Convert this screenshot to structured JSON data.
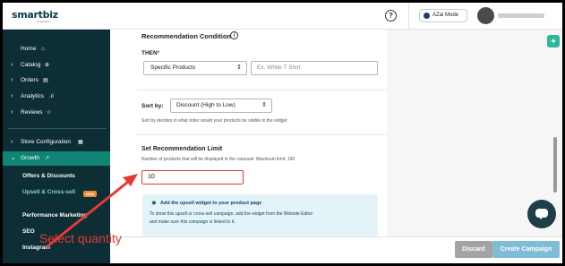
{
  "brand": {
    "logo": "smartbiz",
    "logo_sub": "by amazon"
  },
  "sidebar": {
    "items": [
      {
        "label": "Home",
        "icon": "home-icon"
      },
      {
        "label": "Catalog",
        "icon": "catalog-icon"
      },
      {
        "label": "Orders",
        "icon": "orders-icon"
      },
      {
        "label": "Analytics",
        "icon": "analytics-icon"
      },
      {
        "label": "Reviews",
        "icon": "star-icon"
      },
      {
        "label": "Store Configuration",
        "icon": "store-icon"
      },
      {
        "label": "Growth",
        "icon": "growth-icon"
      }
    ],
    "growth_sub": [
      "Offers & Discounts",
      "Upsell & Cross-sell",
      "Performance Marketing",
      "SEO",
      "Instagram"
    ],
    "new_badge": "NEW"
  },
  "topbar": {
    "mode_label": "AZai Mode"
  },
  "form": {
    "condition_title": "Recommendation Condition",
    "then_label": "THEN",
    "then_required": "*",
    "then_select": "Specific Products",
    "then_input_placeholder": "Ex. White T Shirt",
    "sort_label": "Sort by:",
    "sort_select": "Discount (High to Low)",
    "sort_desc": "Sort by decides in what order would your products be visible in the widget",
    "limit_title": "Set Recommendation Limit",
    "limit_desc": "Number of products that will be displayed in the carousel. Maximum limit: 100",
    "limit_value": "10"
  },
  "info": {
    "title": "Add the upsell widget to your product page",
    "line1": "To show this upsell or cross-sell campaign, add the widget from the Website Editor",
    "line2": "and make sure this campaign is linked to it."
  },
  "actions": {
    "discard": "Discard",
    "create": "Create Campaign"
  },
  "annotation": {
    "label": "Select quantity",
    "color": "#e53935"
  },
  "colors": {
    "sidebar_bg": "#0e2e35",
    "active_nav": "#118575",
    "accent_teal": "#2bb89a",
    "create_btn": "#7fbcd6"
  }
}
